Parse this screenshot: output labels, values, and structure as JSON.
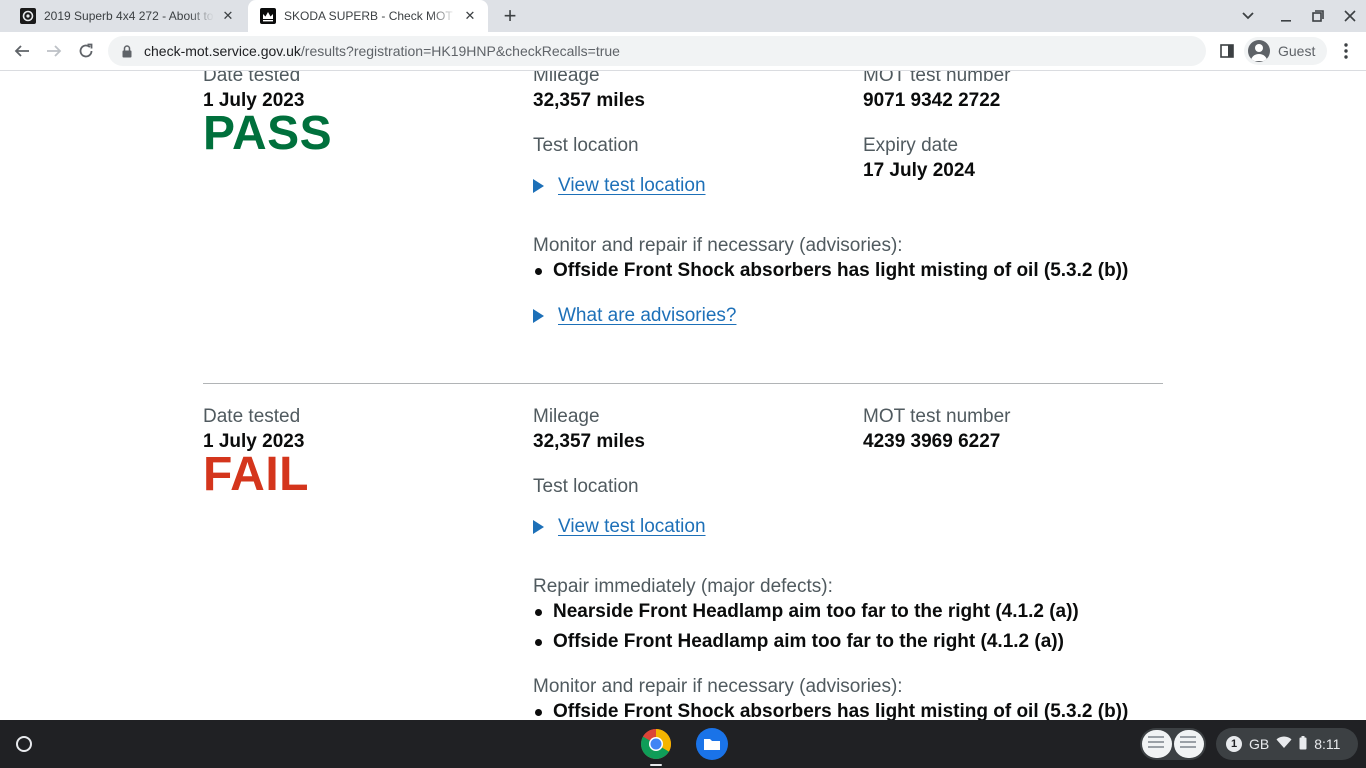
{
  "browser": {
    "tabs": [
      {
        "title": "2019 Superb 4x4 272 - About to",
        "favicon": "camera-icon",
        "active": false
      },
      {
        "title": "SKODA SUPERB - Check MOT his",
        "favicon": "crown-icon",
        "active": true
      }
    ],
    "url_host": "check-mot.service.gov.uk",
    "url_rest": "/results?registration=HK19HNP&checkRecalls=true",
    "profile_label": "Guest"
  },
  "mot_records": [
    {
      "date_label": "Date tested",
      "date": "1 July 2023",
      "result": "PASS",
      "mileage_label": "Mileage",
      "mileage": "32,357 miles",
      "test_number_label": "MOT test number",
      "test_number": "9071 9342 2722",
      "expiry_label": "Expiry date",
      "expiry": "17 July 2024",
      "location_label": "Test location",
      "location_link": "View test location",
      "advisories_label": "Monitor and repair if necessary (advisories):",
      "advisories": [
        "Offside Front Shock absorbers has light misting of oil (5.3.2 (b))"
      ],
      "advisories_link": "What are advisories?"
    },
    {
      "date_label": "Date tested",
      "date": "1 July 2023",
      "result": "FAIL",
      "mileage_label": "Mileage",
      "mileage": "32,357 miles",
      "test_number_label": "MOT test number",
      "test_number": "4239 3969 6227",
      "location_label": "Test location",
      "location_link": "View test location",
      "major_label": "Repair immediately (major defects):",
      "major_defects": [
        "Nearside Front Headlamp aim too far to the right (4.1.2 (a))",
        "Offside Front Headlamp aim too far to the right (4.1.2 (a))"
      ],
      "advisories_label": "Monitor and repair if necessary (advisories):",
      "advisories": [
        "Offside Front Shock absorbers has light misting of oil (5.3.2 (b))"
      ]
    }
  ],
  "shelf": {
    "apps": [
      "chrome-icon",
      "files-icon"
    ],
    "notification_count": "1",
    "keyboard_layout": "GB",
    "time": "8:11"
  },
  "colors": {
    "pass": "#00703c",
    "fail": "#d4351c",
    "link": "#1d70b8"
  }
}
